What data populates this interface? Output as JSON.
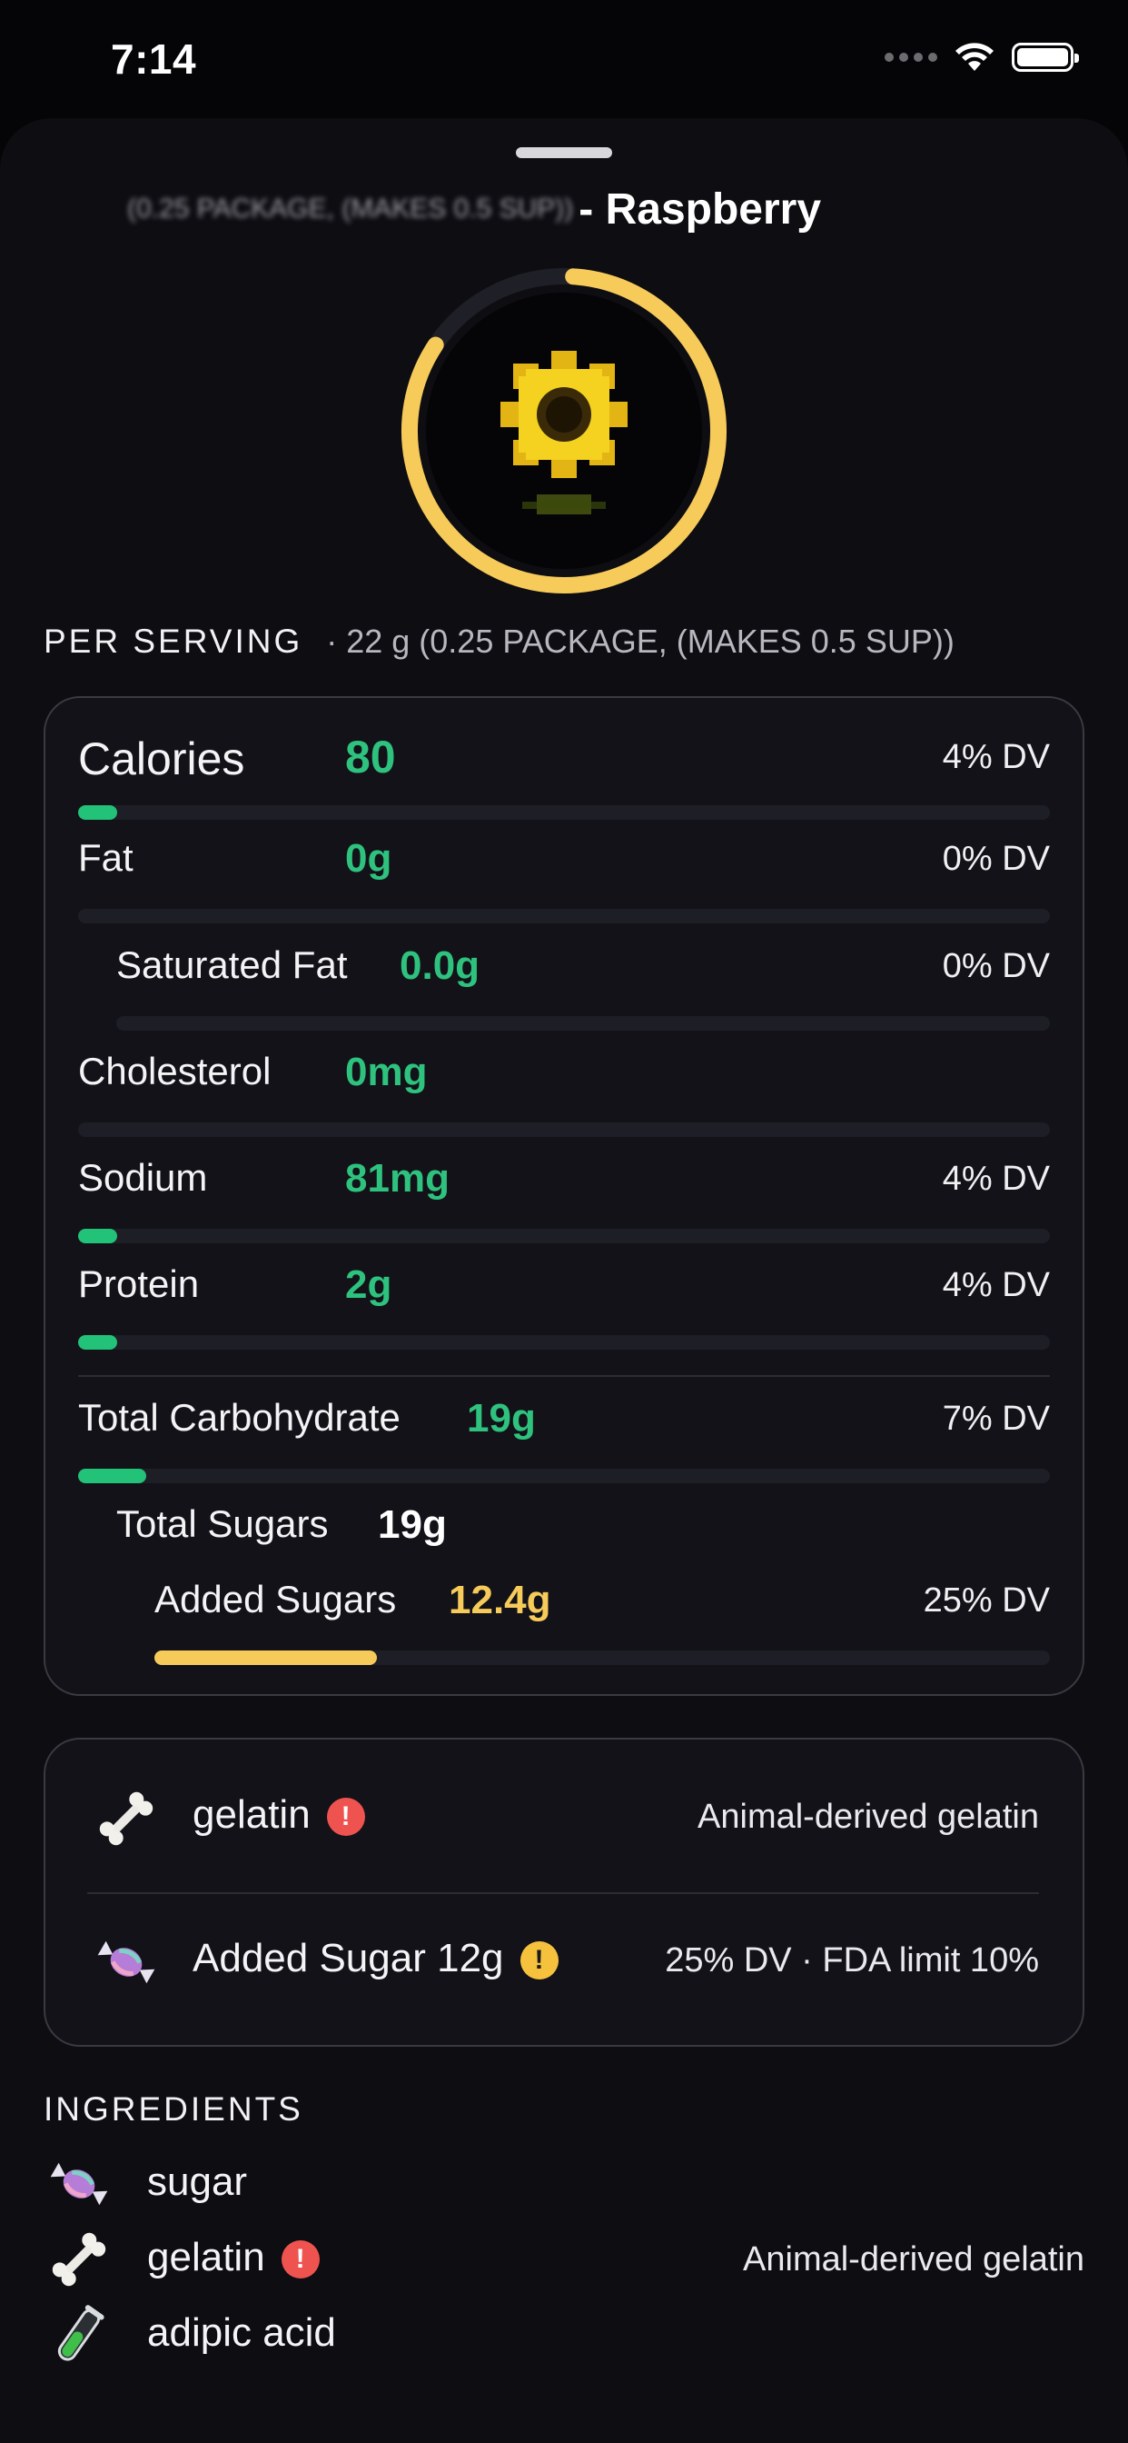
{
  "status_bar": {
    "time": "7:14"
  },
  "header": {
    "title_blurred": "(0.25 PACKAGE, (MAKES 0.5 SUP))",
    "title": "- Raspberry"
  },
  "score": {
    "fill_fraction": 0.97,
    "ring_color": "#F7CB5A",
    "image": "sunflower-icon"
  },
  "per_serving": {
    "label": "PER SERVING",
    "value": "· 22 g (0.25 PACKAGE, (MAKES 0.5 SUP))"
  },
  "nutrition": {
    "rows": [
      {
        "label": "Calories",
        "value": "80",
        "dv": "4% DV",
        "dv_fraction": 0.04
      },
      {
        "label": "Fat",
        "value": "0g",
        "dv": "0% DV",
        "dv_fraction": 0.0
      },
      {
        "label": "Saturated Fat",
        "value": "0.0g",
        "dv": "0% DV",
        "dv_fraction": 0.0
      },
      {
        "label": "Cholesterol",
        "value": "0mg",
        "dv": "",
        "dv_fraction": 0.0
      },
      {
        "label": "Sodium",
        "value": "81mg",
        "dv": "4% DV",
        "dv_fraction": 0.04
      },
      {
        "label": "Protein",
        "value": "2g",
        "dv": "4% DV",
        "dv_fraction": 0.04
      },
      {
        "label": "Total Carbohydrate",
        "value": "19g",
        "dv": "7% DV",
        "dv_fraction": 0.07
      },
      {
        "label": "Total Sugars",
        "value": "19g",
        "dv": "",
        "dv_fraction": 0.0
      },
      {
        "label": "Added Sugars",
        "value": "12.4g",
        "dv": "25% DV",
        "dv_fraction": 0.25
      }
    ],
    "colors": {
      "good": "#2EC27E",
      "warn": "#F7CB5A"
    }
  },
  "alerts": [
    {
      "icon": "bone-icon",
      "label": "gelatin",
      "badge": "!",
      "badge_color": "#EF5350",
      "note": "Animal-derived gelatin"
    },
    {
      "icon": "candy-icon",
      "label": "Added Sugar 12g",
      "badge": "!",
      "badge_color": "#F6C23E",
      "note": "25% DV · FDA limit 10%"
    }
  ],
  "ingredients": {
    "title": "INGREDIENTS",
    "items": [
      {
        "icon": "candy-icon",
        "label": "sugar",
        "note": ""
      },
      {
        "icon": "bone-icon",
        "label": "gelatin",
        "badge": "!",
        "note": "Animal-derived gelatin"
      },
      {
        "icon": "test-tube-icon",
        "label": "adipic acid",
        "note": ""
      }
    ]
  }
}
